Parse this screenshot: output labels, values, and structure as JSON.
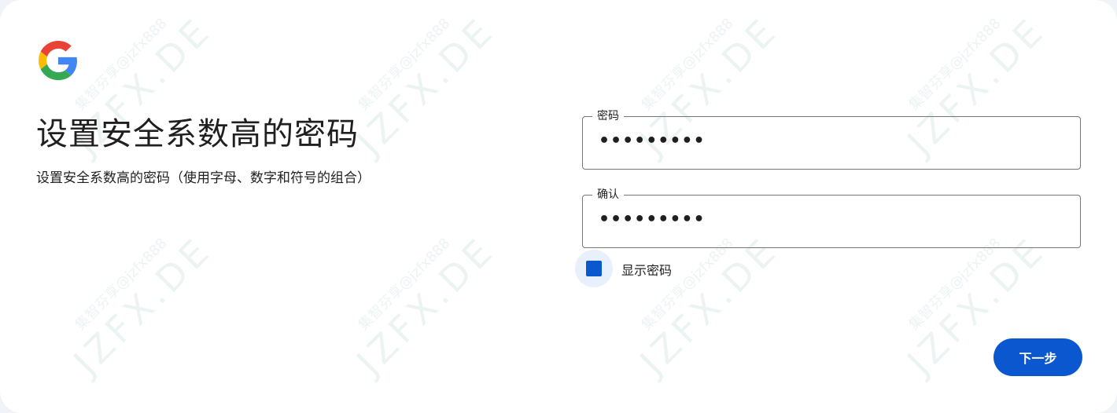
{
  "header": {
    "logo_icon": "google-g-icon",
    "title": "设置安全系数高的密码",
    "subtitle": "设置安全系数高的密码（使用字母、数字和符号的组合）"
  },
  "form": {
    "password": {
      "label": "密码",
      "value": "•••••••••"
    },
    "confirm": {
      "label": "确认",
      "value": "•••••••••"
    },
    "show_password": {
      "label": "显示密码",
      "checked": true
    }
  },
  "actions": {
    "next_label": "下一步"
  },
  "watermark": {
    "handle": "集智芬享@jzfx888",
    "site": "JZFX.DE"
  },
  "colors": {
    "primary": "#0b57d0",
    "text": "#1f1f1f",
    "border": "#747775",
    "background": "#ffffff"
  }
}
